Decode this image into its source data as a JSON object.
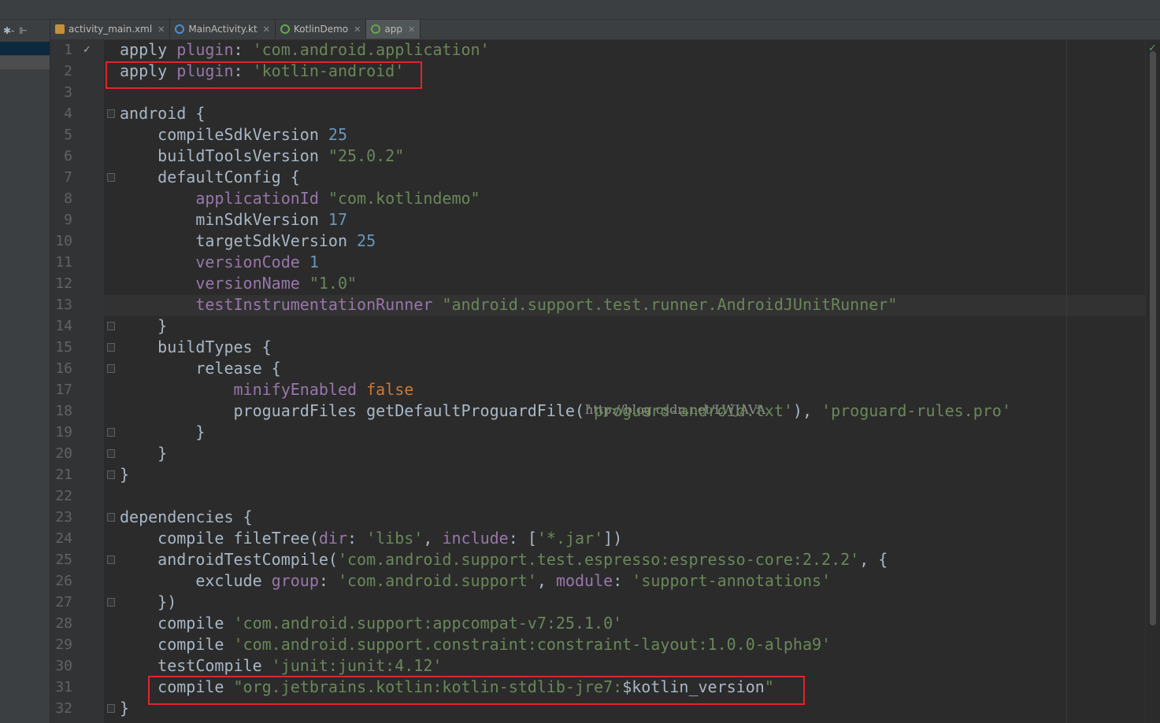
{
  "tabs": [
    {
      "label": "activity_main.xml",
      "icon": "xml-file-icon",
      "active": false
    },
    {
      "label": "MainActivity.kt",
      "icon": "kotlin-file-icon",
      "active": false
    },
    {
      "label": "KotlinDemo",
      "icon": "gradle-icon",
      "active": false
    },
    {
      "label": "app",
      "icon": "gradle-icon",
      "active": true
    }
  ],
  "toolbar": {
    "settings_glyph": "✱-",
    "collapse_glyph": "⊩"
  },
  "editor": {
    "line_numbers": [
      "1",
      "2",
      "3",
      "4",
      "5",
      "6",
      "7",
      "8",
      "9",
      "10",
      "11",
      "12",
      "13",
      "14",
      "15",
      "16",
      "17",
      "18",
      "19",
      "20",
      "21",
      "22",
      "23",
      "24",
      "25",
      "26",
      "27",
      "28",
      "29",
      "30",
      "31",
      "32"
    ],
    "lines": [
      "apply plugin: 'com.android.application'",
      "apply plugin: 'kotlin-android'",
      "",
      "android {",
      "    compileSdkVersion 25",
      "    buildToolsVersion \"25.0.2\"",
      "    defaultConfig {",
      "        applicationId \"com.kotlindemo\"",
      "        minSdkVersion 17",
      "        targetSdkVersion 25",
      "        versionCode 1",
      "        versionName \"1.0\"",
      "        testInstrumentationRunner \"android.support.test.runner.AndroidJUnitRunner\"",
      "    }",
      "    buildTypes {",
      "        release {",
      "            minifyEnabled false",
      "            proguardFiles getDefaultProguardFile('proguard-android.txt'), 'proguard-rules.pro'",
      "        }",
      "    }",
      "}",
      "",
      "dependencies {",
      "    compile fileTree(dir: 'libs', include: ['*.jar'])",
      "    androidTestCompile('com.android.support.test.espresso:espresso-core:2.2.2', {",
      "        exclude group: 'com.android.support', module: 'support-annotations'",
      "    })",
      "    compile 'com.android.support:appcompat-v7:25.1.0'",
      "    compile 'com.android.support.constraint:constraint-layout:1.0.0-alpha9'",
      "    testCompile 'junit:junit:4.12'",
      "    compile \"org.jetbrains.kotlin:kotlin-stdlib-jre7:$kotlin_version\"",
      "}"
    ],
    "current_line": 13,
    "highlighted_lines": [
      2,
      31
    ]
  },
  "watermark": "http://blog.csdn.net/LWJAVA",
  "colors": {
    "background": "#2b2b2b",
    "string": "#6a8759",
    "number": "#6897bb",
    "property": "#9876aa",
    "keyword": "#cc7832",
    "text": "#a9b7c6",
    "highlight_box": "#e0252a"
  }
}
